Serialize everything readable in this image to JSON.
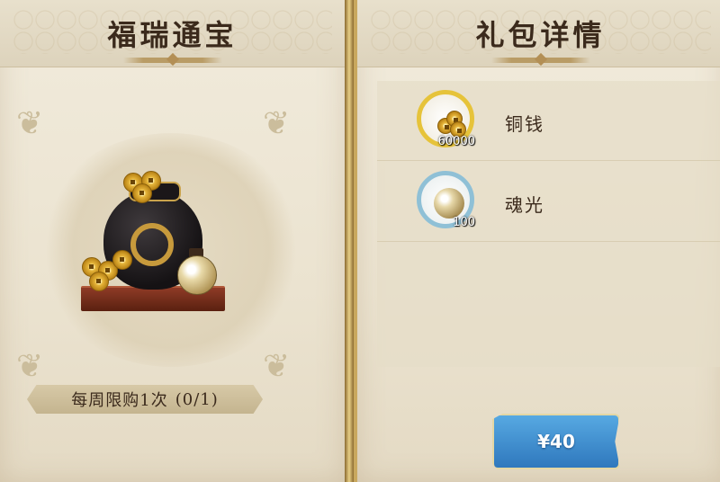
{
  "left_panel": {
    "title": "福瑞通宝",
    "purchase_limit": {
      "label": "每周限购1次",
      "count": "(0/1)"
    }
  },
  "right_panel": {
    "title": "礼包详情",
    "items": [
      {
        "name": "铜钱",
        "quantity": "60000",
        "icon": "copper-coins-icon",
        "ring_color": "#e6c33a"
      },
      {
        "name": "魂光",
        "quantity": "100",
        "icon": "soul-light-jar-icon",
        "ring_color": "#8fc0d6"
      }
    ],
    "buy_button": {
      "label": "¥40",
      "color": "#3d8fd0"
    }
  },
  "colors": {
    "panel_bg": "#ede6d4",
    "frame_gold": "#c9a85e",
    "text_dark": "#3b2a1c"
  }
}
